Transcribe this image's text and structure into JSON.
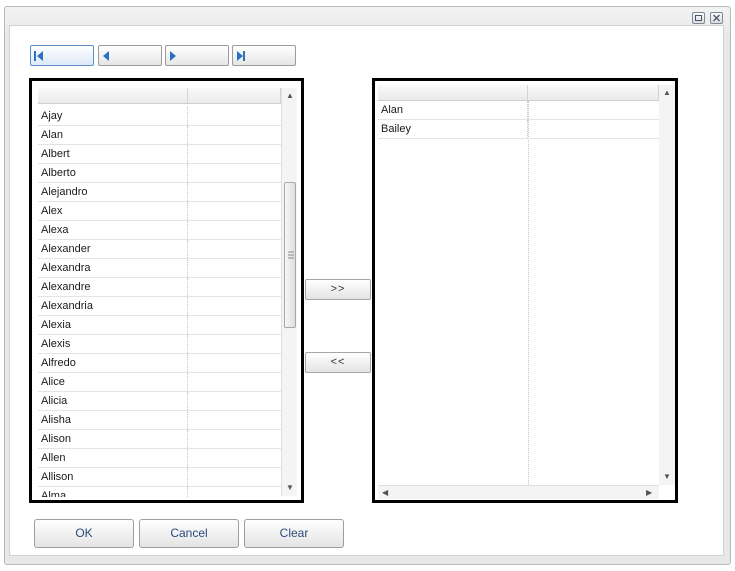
{
  "window": {
    "controls": [
      "restore-icon",
      "close-icon"
    ]
  },
  "pager": {
    "buttons": [
      "first-page-icon",
      "previous-page-icon",
      "next-page-icon",
      "last-page-icon"
    ]
  },
  "left_list": {
    "columns": [
      "",
      ""
    ],
    "rows": [
      "Ajay",
      "Alan",
      "Albert",
      "Alberto",
      "Alejandro",
      "Alex",
      "Alexa",
      "Alexander",
      "Alexandra",
      "Alexandre",
      "Alexandria",
      "Alexia",
      "Alexis",
      "Alfredo",
      "Alice",
      "Alicia",
      "Alisha",
      "Alison",
      "Allen",
      "Allison",
      "Alma"
    ]
  },
  "right_list": {
    "columns": [
      "",
      ""
    ],
    "rows": [
      "Alan",
      "Bailey"
    ]
  },
  "transfer": {
    "add_label": ">>",
    "remove_label": "<<"
  },
  "actions": {
    "ok_label": "OK",
    "cancel_label": "Cancel",
    "clear_label": "Clear"
  },
  "colors": {
    "accent": "#2f6fc2",
    "border": "#000000"
  }
}
